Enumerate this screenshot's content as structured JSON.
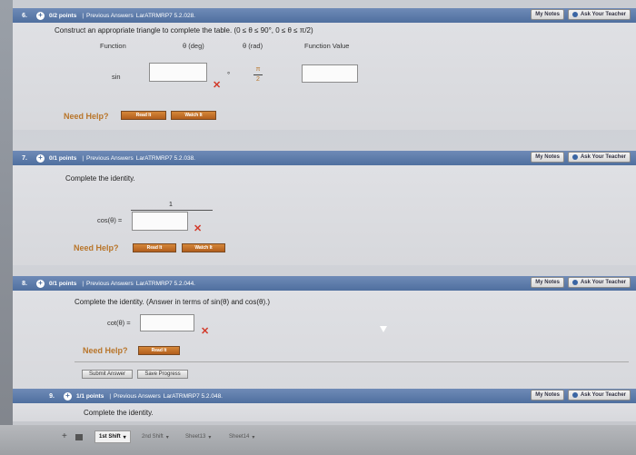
{
  "q6": {
    "num": "6.",
    "points": "0/2 points",
    "sep": "|",
    "prev": "Previous Answers",
    "code": "LarATRMRP7 5.2.028.",
    "my_notes": "My Notes",
    "ask": "Ask Your Teacher",
    "prompt": "Construct an appropriate triangle to complete the table. (0 ≤ θ ≤ 90°, 0 ≤ θ ≤ π/2)",
    "col1": "Function",
    "col2": "θ (deg)",
    "col3": "θ (rad)",
    "col4": "Function Value",
    "row_fn": "sin",
    "degree": "°",
    "frac_num": "π",
    "frac_den": "2",
    "need_help": "Need Help?",
    "read_it": "Read It",
    "watch_it": "Watch It"
  },
  "q7": {
    "num": "7.",
    "points": "0/1 points",
    "sep": "|",
    "prev": "Previous Answers",
    "code": "LarATRMRP7 5.2.038.",
    "my_notes": "My Notes",
    "ask": "Ask Your Teacher",
    "prompt": "Complete the identity.",
    "frac_num": "1",
    "lhs": "cos(θ) =",
    "need_help": "Need Help?",
    "read_it": "Read It",
    "watch_it": "Watch It"
  },
  "q8": {
    "num": "8.",
    "points": "0/1 points",
    "sep": "|",
    "prev": "Previous Answers",
    "code": "LarATRMRP7 5.2.044.",
    "my_notes": "My Notes",
    "ask": "Ask Your Teacher",
    "prompt": "Complete the identity. (Answer in terms of sin(θ) and cos(θ).)",
    "lhs": "cot(θ) =",
    "need_help": "Need Help?",
    "read_it": "Read It",
    "submit": "Submit Answer",
    "save": "Save Progress"
  },
  "q9": {
    "num": "9.",
    "points": "1/1 points",
    "sep": "|",
    "prev": "Previous Answers",
    "code": "LarATRMRP7 5.2.048.",
    "my_notes": "My Notes",
    "ask": "Ask Your Teacher",
    "prompt": "Complete the identity."
  },
  "sheets": [
    {
      "label": "1st Shift"
    },
    {
      "label": "2nd Shift"
    },
    {
      "label": "Sheet13"
    },
    {
      "label": "Sheet14"
    }
  ],
  "colors": {
    "header": "#4f6f9f",
    "need_help": "#b8752a",
    "error": "#d23a2a"
  }
}
